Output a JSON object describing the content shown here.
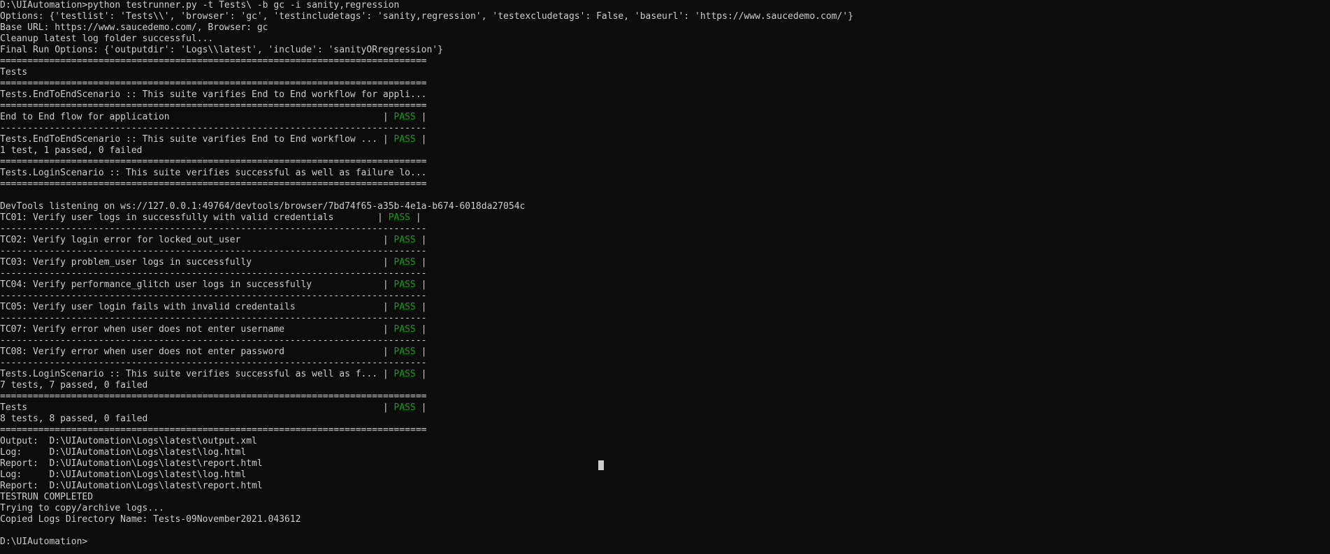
{
  "console": {
    "lines": [
      {
        "pre": "D:\\UIAutomation>python testrunner.py -t Tests\\ -b gc -i sanity,regression"
      },
      {
        "pre": "Options: {'testlist': 'Tests\\\\', 'browser': 'gc', 'testincludetags': 'sanity,regression', 'testexcludetags': False, 'baseurl': 'https://www.saucedemo.com/'}"
      },
      {
        "pre": "Base URL: https://www.saucedemo.com/, Browser: gc"
      },
      {
        "pre": "Cleanup latest log folder successful..."
      },
      {
        "pre": "Final Run Options: {'outputdir': 'Logs\\\\latest', 'include': 'sanityORregression'}"
      },
      {
        "pre": "=============================================================================="
      },
      {
        "pre": "Tests"
      },
      {
        "pre": "=============================================================================="
      },
      {
        "pre": "Tests.EndToEndScenario :: This suite varifies End to End workflow for appli..."
      },
      {
        "pre": "=============================================================================="
      },
      {
        "pre": "End to End flow for application                                       | ",
        "status": "PASS",
        "post": " |"
      },
      {
        "pre": "------------------------------------------------------------------------------"
      },
      {
        "pre": "Tests.EndToEndScenario :: This suite varifies End to End workflow ... | ",
        "status": "PASS",
        "post": " |"
      },
      {
        "pre": "1 test, 1 passed, 0 failed"
      },
      {
        "pre": "=============================================================================="
      },
      {
        "pre": "Tests.LoginScenario :: This suite verifies successful as well as failure lo..."
      },
      {
        "pre": "=============================================================================="
      },
      {
        "pre": ""
      },
      {
        "pre": "DevTools listening on ws://127.0.0.1:49764/devtools/browser/7bd74f65-a35b-4e1a-b674-6018da27054c"
      },
      {
        "pre": "TC01: Verify user logs in successfully with valid credentials        | ",
        "status": "PASS",
        "post": " |"
      },
      {
        "pre": "------------------------------------------------------------------------------"
      },
      {
        "pre": "TC02: Verify login error for locked_out_user                          | ",
        "status": "PASS",
        "post": " |"
      },
      {
        "pre": "------------------------------------------------------------------------------"
      },
      {
        "pre": "TC03: Verify problem_user logs in successfully                        | ",
        "status": "PASS",
        "post": " |"
      },
      {
        "pre": "------------------------------------------------------------------------------"
      },
      {
        "pre": "TC04: Verify performance_glitch user logs in successfully             | ",
        "status": "PASS",
        "post": " |"
      },
      {
        "pre": "------------------------------------------------------------------------------"
      },
      {
        "pre": "TC05: Verify user login fails with invalid credentails                | ",
        "status": "PASS",
        "post": " |"
      },
      {
        "pre": "------------------------------------------------------------------------------"
      },
      {
        "pre": "TC07: Verify error when user does not enter username                  | ",
        "status": "PASS",
        "post": " |"
      },
      {
        "pre": "------------------------------------------------------------------------------"
      },
      {
        "pre": "TC08: Verify error when user does not enter password                  | ",
        "status": "PASS",
        "post": " |"
      },
      {
        "pre": "------------------------------------------------------------------------------"
      },
      {
        "pre": "Tests.LoginScenario :: This suite verifies successful as well as f... | ",
        "status": "PASS",
        "post": " |"
      },
      {
        "pre": "7 tests, 7 passed, 0 failed"
      },
      {
        "pre": "=============================================================================="
      },
      {
        "pre": "Tests                                                                 | ",
        "status": "PASS",
        "post": " |"
      },
      {
        "pre": "8 tests, 8 passed, 0 failed"
      },
      {
        "pre": "=============================================================================="
      },
      {
        "pre": "Output:  D:\\UIAutomation\\Logs\\latest\\output.xml"
      },
      {
        "pre": "Log:     D:\\UIAutomation\\Logs\\latest\\log.html"
      },
      {
        "pre": "Report:  D:\\UIAutomation\\Logs\\latest\\report.html"
      },
      {
        "pre": "Log:     D:\\UIAutomation\\Logs\\latest\\log.html"
      },
      {
        "pre": "Report:  D:\\UIAutomation\\Logs\\latest\\report.html"
      },
      {
        "pre": "TESTRUN COMPLETED"
      },
      {
        "pre": "Trying to copy/archive logs..."
      },
      {
        "pre": "Copied Logs Directory Name: Tests-09November2021.043612"
      },
      {
        "pre": ""
      },
      {
        "pre": "D:\\UIAutomation>"
      }
    ]
  },
  "colors": {
    "background": "#0c0c0c",
    "text": "#cccccc",
    "pass": "#13a10e"
  }
}
